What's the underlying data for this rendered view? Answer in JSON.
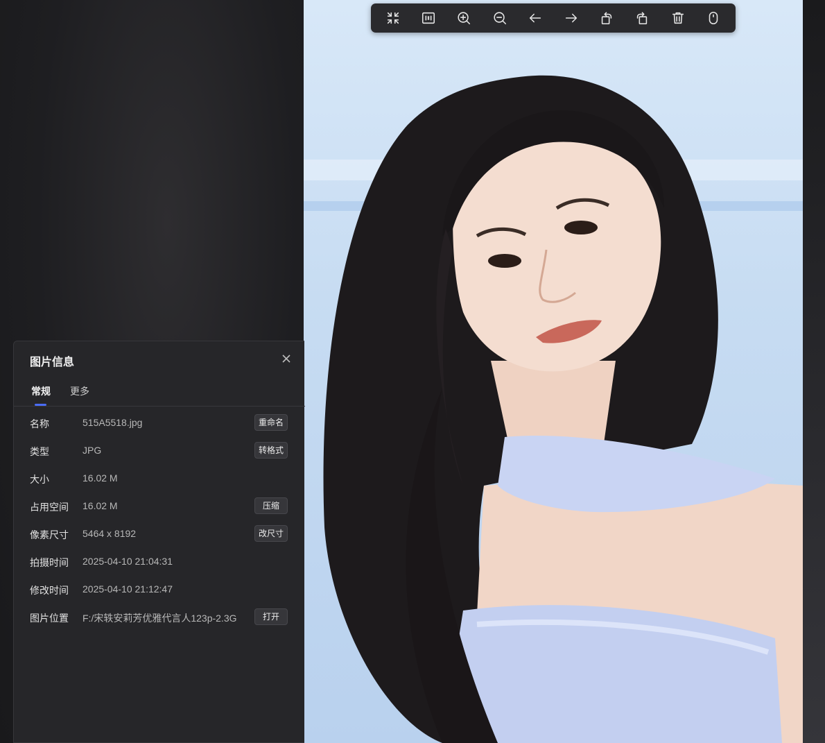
{
  "toolbar": {
    "buttons": [
      {
        "icon": "exit-fullscreen-icon"
      },
      {
        "icon": "actual-size-icon"
      },
      {
        "icon": "zoom-in-icon"
      },
      {
        "icon": "zoom-out-icon"
      },
      {
        "icon": "previous-arrow-icon"
      },
      {
        "icon": "next-arrow-icon"
      },
      {
        "icon": "rotate-left-icon"
      },
      {
        "icon": "rotate-right-icon"
      },
      {
        "icon": "trash-icon"
      },
      {
        "icon": "mouse-icon"
      }
    ]
  },
  "panel": {
    "title": "图片信息",
    "tabs": [
      {
        "label": "常规",
        "active": true
      },
      {
        "label": "更多",
        "active": false
      }
    ],
    "rows": [
      {
        "label": "名称",
        "value": "515A5518.jpg",
        "action": "重命名"
      },
      {
        "label": "类型",
        "value": "JPG",
        "action": "转格式"
      },
      {
        "label": "大小",
        "value": "16.02 M",
        "action": ""
      },
      {
        "label": "占用空间",
        "value": "16.02 M",
        "action": "压缩"
      },
      {
        "label": "像素尺寸",
        "value": "5464 x 8192",
        "action": "改尺寸"
      },
      {
        "label": "拍摄时间",
        "value": "2025-04-10 21:04:31",
        "action": ""
      },
      {
        "label": "修改时间",
        "value": "2025-04-10 21:12:47",
        "action": ""
      },
      {
        "label": "图片位置",
        "value": "F:/宋轶安莉芳优雅代言人123p-2.3G",
        "action": "打开"
      }
    ]
  },
  "colors": {
    "accent": "#4a6cf7",
    "panel_bg": "#262629",
    "toolbar_bg": "#2a2a2d"
  }
}
